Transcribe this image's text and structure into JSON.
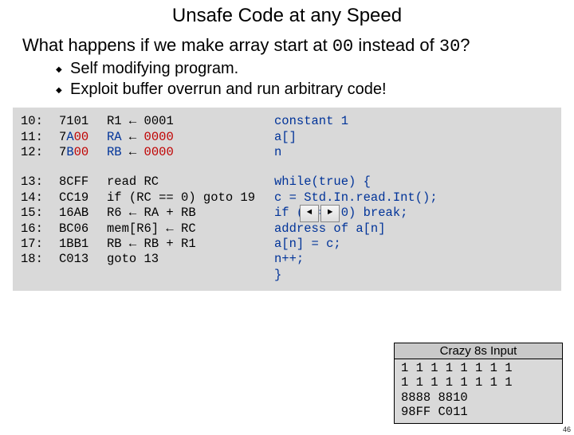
{
  "title": "Unsafe Code at any Speed",
  "question": {
    "pre": "What happens if we make array start at ",
    "code1": "00",
    "mid": " instead of ",
    "code2": "30",
    "post": "?"
  },
  "bullets": [
    "Self modifying program.",
    "Exploit buffer overrun and run arbitrary code!"
  ],
  "code": {
    "top": {
      "addr": [
        "10:",
        "11:",
        "12:"
      ],
      "hex": [
        "7101",
        "7A00",
        "7B00"
      ],
      "mid": [
        {
          "lhs": "R1",
          "arrow": "←",
          "rhs": "0001"
        },
        {
          "lhs": "RA",
          "arrow": "←",
          "rhs": "0000"
        },
        {
          "lhs": "RB",
          "arrow": "←",
          "rhs": "0000"
        }
      ],
      "right": [
        "constant 1",
        "a[]",
        "n"
      ]
    },
    "bot": {
      "addr": [
        "13:",
        "14:",
        "15:",
        "16:",
        "17:",
        "18:"
      ],
      "hex": [
        "8CFF",
        "CC19",
        "16AB",
        "BC06",
        "1BB1",
        "C013"
      ],
      "midraw": [
        "read RC",
        "if (RC == 0) goto 19",
        "R6 ← RA + RB",
        "mem[R6] ← RC",
        "RB ← RB + R1",
        "goto 13"
      ],
      "rightC": {
        "head": "while(true) {",
        "lines": [
          "   c = Std.In.read.Int();",
          "   if (c == 0) break;",
          "   address of a[n]",
          "   a[n] = c;",
          "   n++;"
        ],
        "tail": "}"
      }
    }
  },
  "crazy": {
    "title": "Crazy 8s Input",
    "body": "1 1 1 1 1 1 1 1\n1 1 1 1 1 1 1 1\n8888 8810\n98FF C011"
  },
  "nav": {
    "prev": "◄",
    "next": "►"
  },
  "pagenum": "46"
}
